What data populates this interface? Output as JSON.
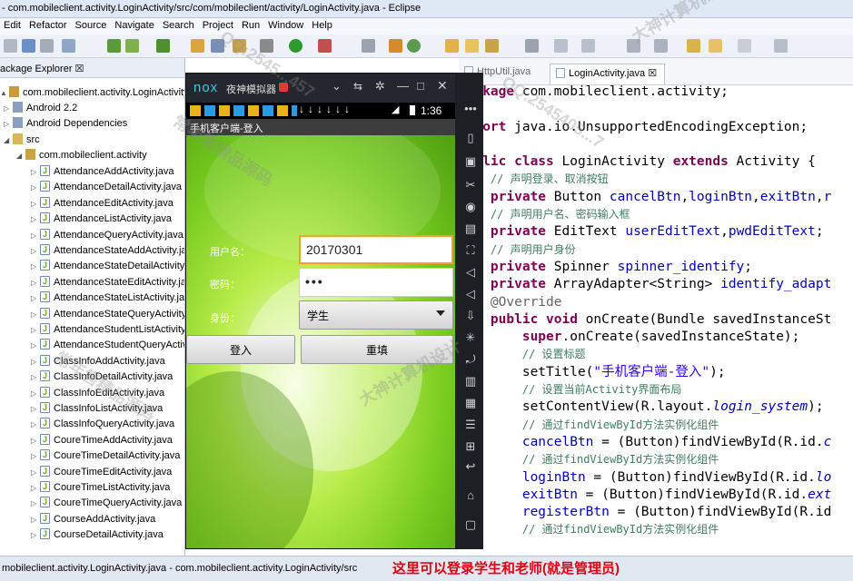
{
  "window": {
    "title": "- com.mobileclient.activity.LoginActivity/src/com/mobileclient/activity/LoginActivity.java - Eclipse"
  },
  "menu": [
    "Edit",
    "Refactor",
    "Source",
    "Navigate",
    "Search",
    "Project",
    "Run",
    "Window",
    "Help"
  ],
  "package_explorer": {
    "tab_label": "ackage Explorer ☒",
    "project": "com.mobileclient.activity.LoginActivity",
    "android": "Android 2.2",
    "deps": "Android Dependencies",
    "src": "src",
    "package": "com.mobileclient.activity",
    "files": [
      "AttendanceAddActivity.java",
      "AttendanceDetailActivity.java",
      "AttendanceEditActivity.java",
      "AttendanceListActivity.java",
      "AttendanceQueryActivity.java",
      "AttendanceStateAddActivity.java",
      "AttendanceStateDetailActivity.java",
      "AttendanceStateEditActivity.java",
      "AttendanceStateListActivity.java",
      "AttendanceStateQueryActivity.java",
      "AttendanceStudentListActivity.java",
      "AttendanceStudentQueryActivity.java",
      "ClassInfoAddActivity.java",
      "ClassInfoDetailActivity.java",
      "ClassInfoEditActivity.java",
      "ClassInfoListActivity.java",
      "ClassInfoQueryActivity.java",
      "CoureTimeAddActivity.java",
      "CoureTimeDetailActivity.java",
      "CoureTimeEditActivity.java",
      "CoureTimeListActivity.java",
      "CoureTimeQueryActivity.java",
      "CourseAddActivity.java",
      "CourseDetailActivity.java"
    ]
  },
  "editor": {
    "tabs": [
      "HttpUtil.java",
      "LoginActivity.java ☒"
    ]
  },
  "emulator": {
    "brand": "nox",
    "name": "夜神模拟器",
    "time": "1:36",
    "app_title": "手机客户端-登入",
    "username_label": "用户名：",
    "username_value": "20170301",
    "password_label": "密码：",
    "password_value": "•••",
    "role_label": "身份：",
    "role_value": "学生",
    "login_button": "登入",
    "reset_button": "重填"
  },
  "statusbar": {
    "path": "mobileclient.activity.LoginActivity.java - com.mobileclient.activity.LoginActivity/src",
    "caption": "这里可以登录学生和老师(就是管理员)"
  },
  "watermarks": [
    "常年售精品源码",
    "QQ:2545...457",
    "大神计算机设计",
    "QQ:2545405...7",
    "常年售精品源码",
    "大神计算机设计"
  ],
  "colors": {
    "keyword": "#7f0055",
    "comment": "#3f7f5f",
    "field": "#0000c0",
    "string": "#2a00ff",
    "caption": "#e60012"
  }
}
